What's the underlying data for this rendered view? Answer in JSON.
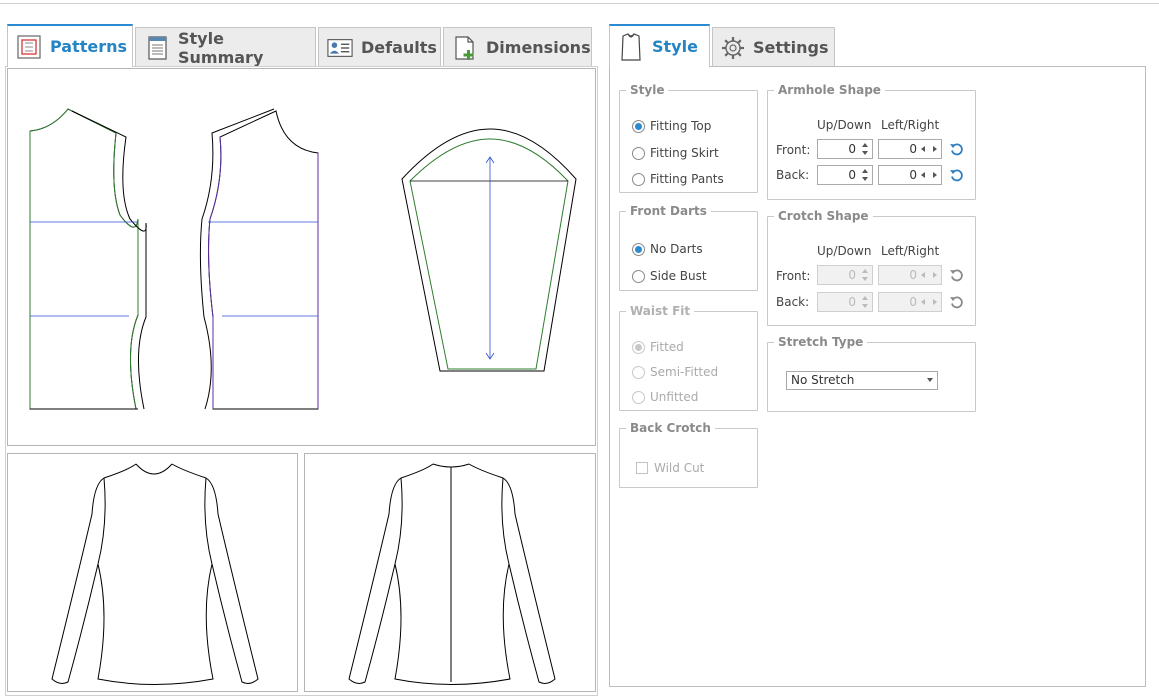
{
  "left_tabs": [
    {
      "label": "Patterns",
      "icon": "patterns-icon",
      "active": true
    },
    {
      "label": "Style Summary",
      "icon": "style-summary-icon",
      "active": false
    },
    {
      "label": "Defaults",
      "icon": "defaults-icon",
      "active": false
    },
    {
      "label": "Dimensions",
      "icon": "dimensions-icon",
      "active": false
    }
  ],
  "right_tabs": [
    {
      "label": "Style",
      "icon": "shirt-icon",
      "active": true
    },
    {
      "label": "Settings",
      "icon": "gear-icon",
      "active": false
    }
  ],
  "style_group": {
    "legend": "Style",
    "options": [
      "Fitting Top",
      "Fitting Skirt",
      "Fitting Pants"
    ],
    "selected": "Fitting Top"
  },
  "front_darts": {
    "legend": "Front Darts",
    "options": [
      "No Darts",
      "Side Bust"
    ],
    "selected": "No Darts"
  },
  "waist_fit": {
    "legend": "Waist Fit",
    "options": [
      "Fitted",
      "Semi-Fitted",
      "Unfitted"
    ],
    "selected": "Fitted",
    "disabled": true
  },
  "back_crotch": {
    "legend": "Back Crotch",
    "checkbox_label": "Wild Cut",
    "checked": false,
    "disabled": true
  },
  "armhole_shape": {
    "legend": "Armhole Shape",
    "col_updown": "Up/Down",
    "col_leftright": "Left/Right",
    "front_label": "Front:",
    "back_label": "Back:",
    "front_updown": "0",
    "front_leftright": "0",
    "back_updown": "0",
    "back_leftright": "0"
  },
  "crotch_shape": {
    "legend": "Crotch Shape",
    "col_updown": "Up/Down",
    "col_leftright": "Left/Right",
    "front_label": "Front:",
    "back_label": "Back:",
    "front_updown": "0",
    "front_leftright": "0",
    "back_updown": "0",
    "back_leftright": "0",
    "disabled": true
  },
  "stretch_type": {
    "legend": "Stretch Type",
    "value": "No Stretch"
  },
  "colors": {
    "accent": "#2a8bd0",
    "seam_green": "#2f7d2f",
    "grain_blue": "#2f4fd0",
    "cut_line": "#000000"
  }
}
